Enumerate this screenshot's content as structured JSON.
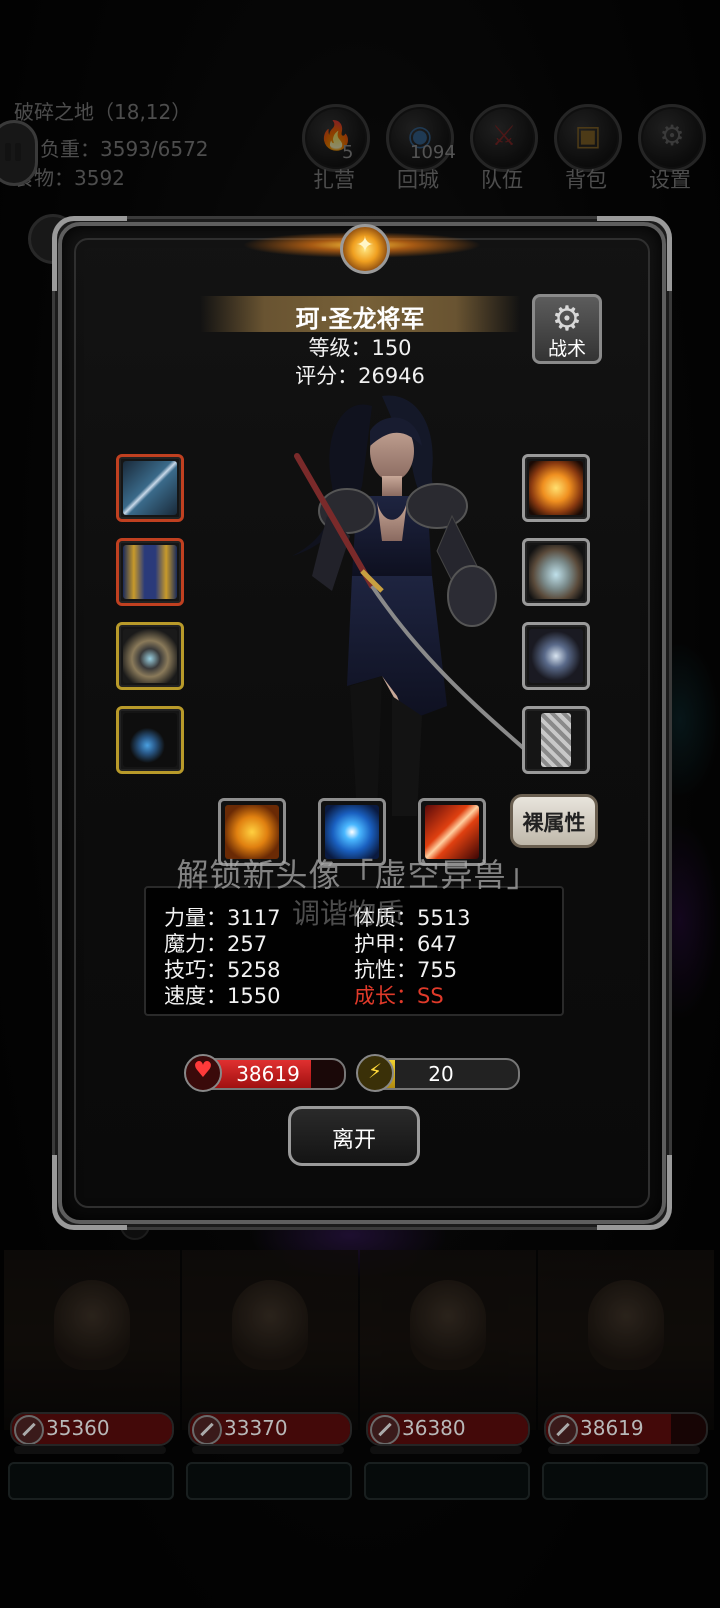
{
  "hud": {
    "location": "破碎之地（18,12）",
    "weight": "负重：3593/6572",
    "food": "食物：3592",
    "buttons": [
      {
        "label": "扎营",
        "badge": "5",
        "icon": "campfire-icon"
      },
      {
        "label": "回城",
        "badge": "1094",
        "icon": "portal-icon"
      },
      {
        "label": "队伍",
        "badge": "",
        "icon": "team-icon"
      },
      {
        "label": "背包",
        "badge": "",
        "icon": "backpack-icon"
      },
      {
        "label": "设置",
        "badge": "",
        "icon": "gear-icon"
      }
    ]
  },
  "dialog": {
    "name": "珂·圣龙将军",
    "level": "等级：150",
    "score": "评分：26946",
    "tactics_label": "战术",
    "bare_attr_label": "裸属性",
    "unlock_text": "解锁新头像「虚空异兽」",
    "unlock_sub": "调谐物质",
    "left_equipment": [
      "sword-icon",
      "armor-icon",
      "helmet-icon",
      "necklace-icon"
    ],
    "right_equipment": [
      "flame-ring-icon",
      "stone-icon",
      "emblem-icon",
      "chainmail-icon"
    ],
    "skills": [
      "shield-skill-icon",
      "eye-skill-icon",
      "slash-skill-icon"
    ],
    "stats": {
      "strength": "力量：3117",
      "constitution": "体质：5513",
      "magic": "魔力：257",
      "armor": "护甲：647",
      "skill": "技巧：5258",
      "resistance": "抗性：755",
      "speed": "速度：1550",
      "growth": "成长：SS"
    },
    "hp_value": "38619",
    "hp_fraction": 0.78,
    "energy_value": "20",
    "energy_fraction": 0.2,
    "leave_label": "离开"
  },
  "party": [
    {
      "hp": "35360",
      "fraction": 1.0
    },
    {
      "hp": "33370",
      "fraction": 1.0
    },
    {
      "hp": "36380",
      "fraction": 1.0
    },
    {
      "hp": "38619",
      "fraction": 0.78
    }
  ],
  "colors": {
    "growth": "#e03a2a",
    "hp": "#d02020",
    "energy": "#f0d030"
  }
}
